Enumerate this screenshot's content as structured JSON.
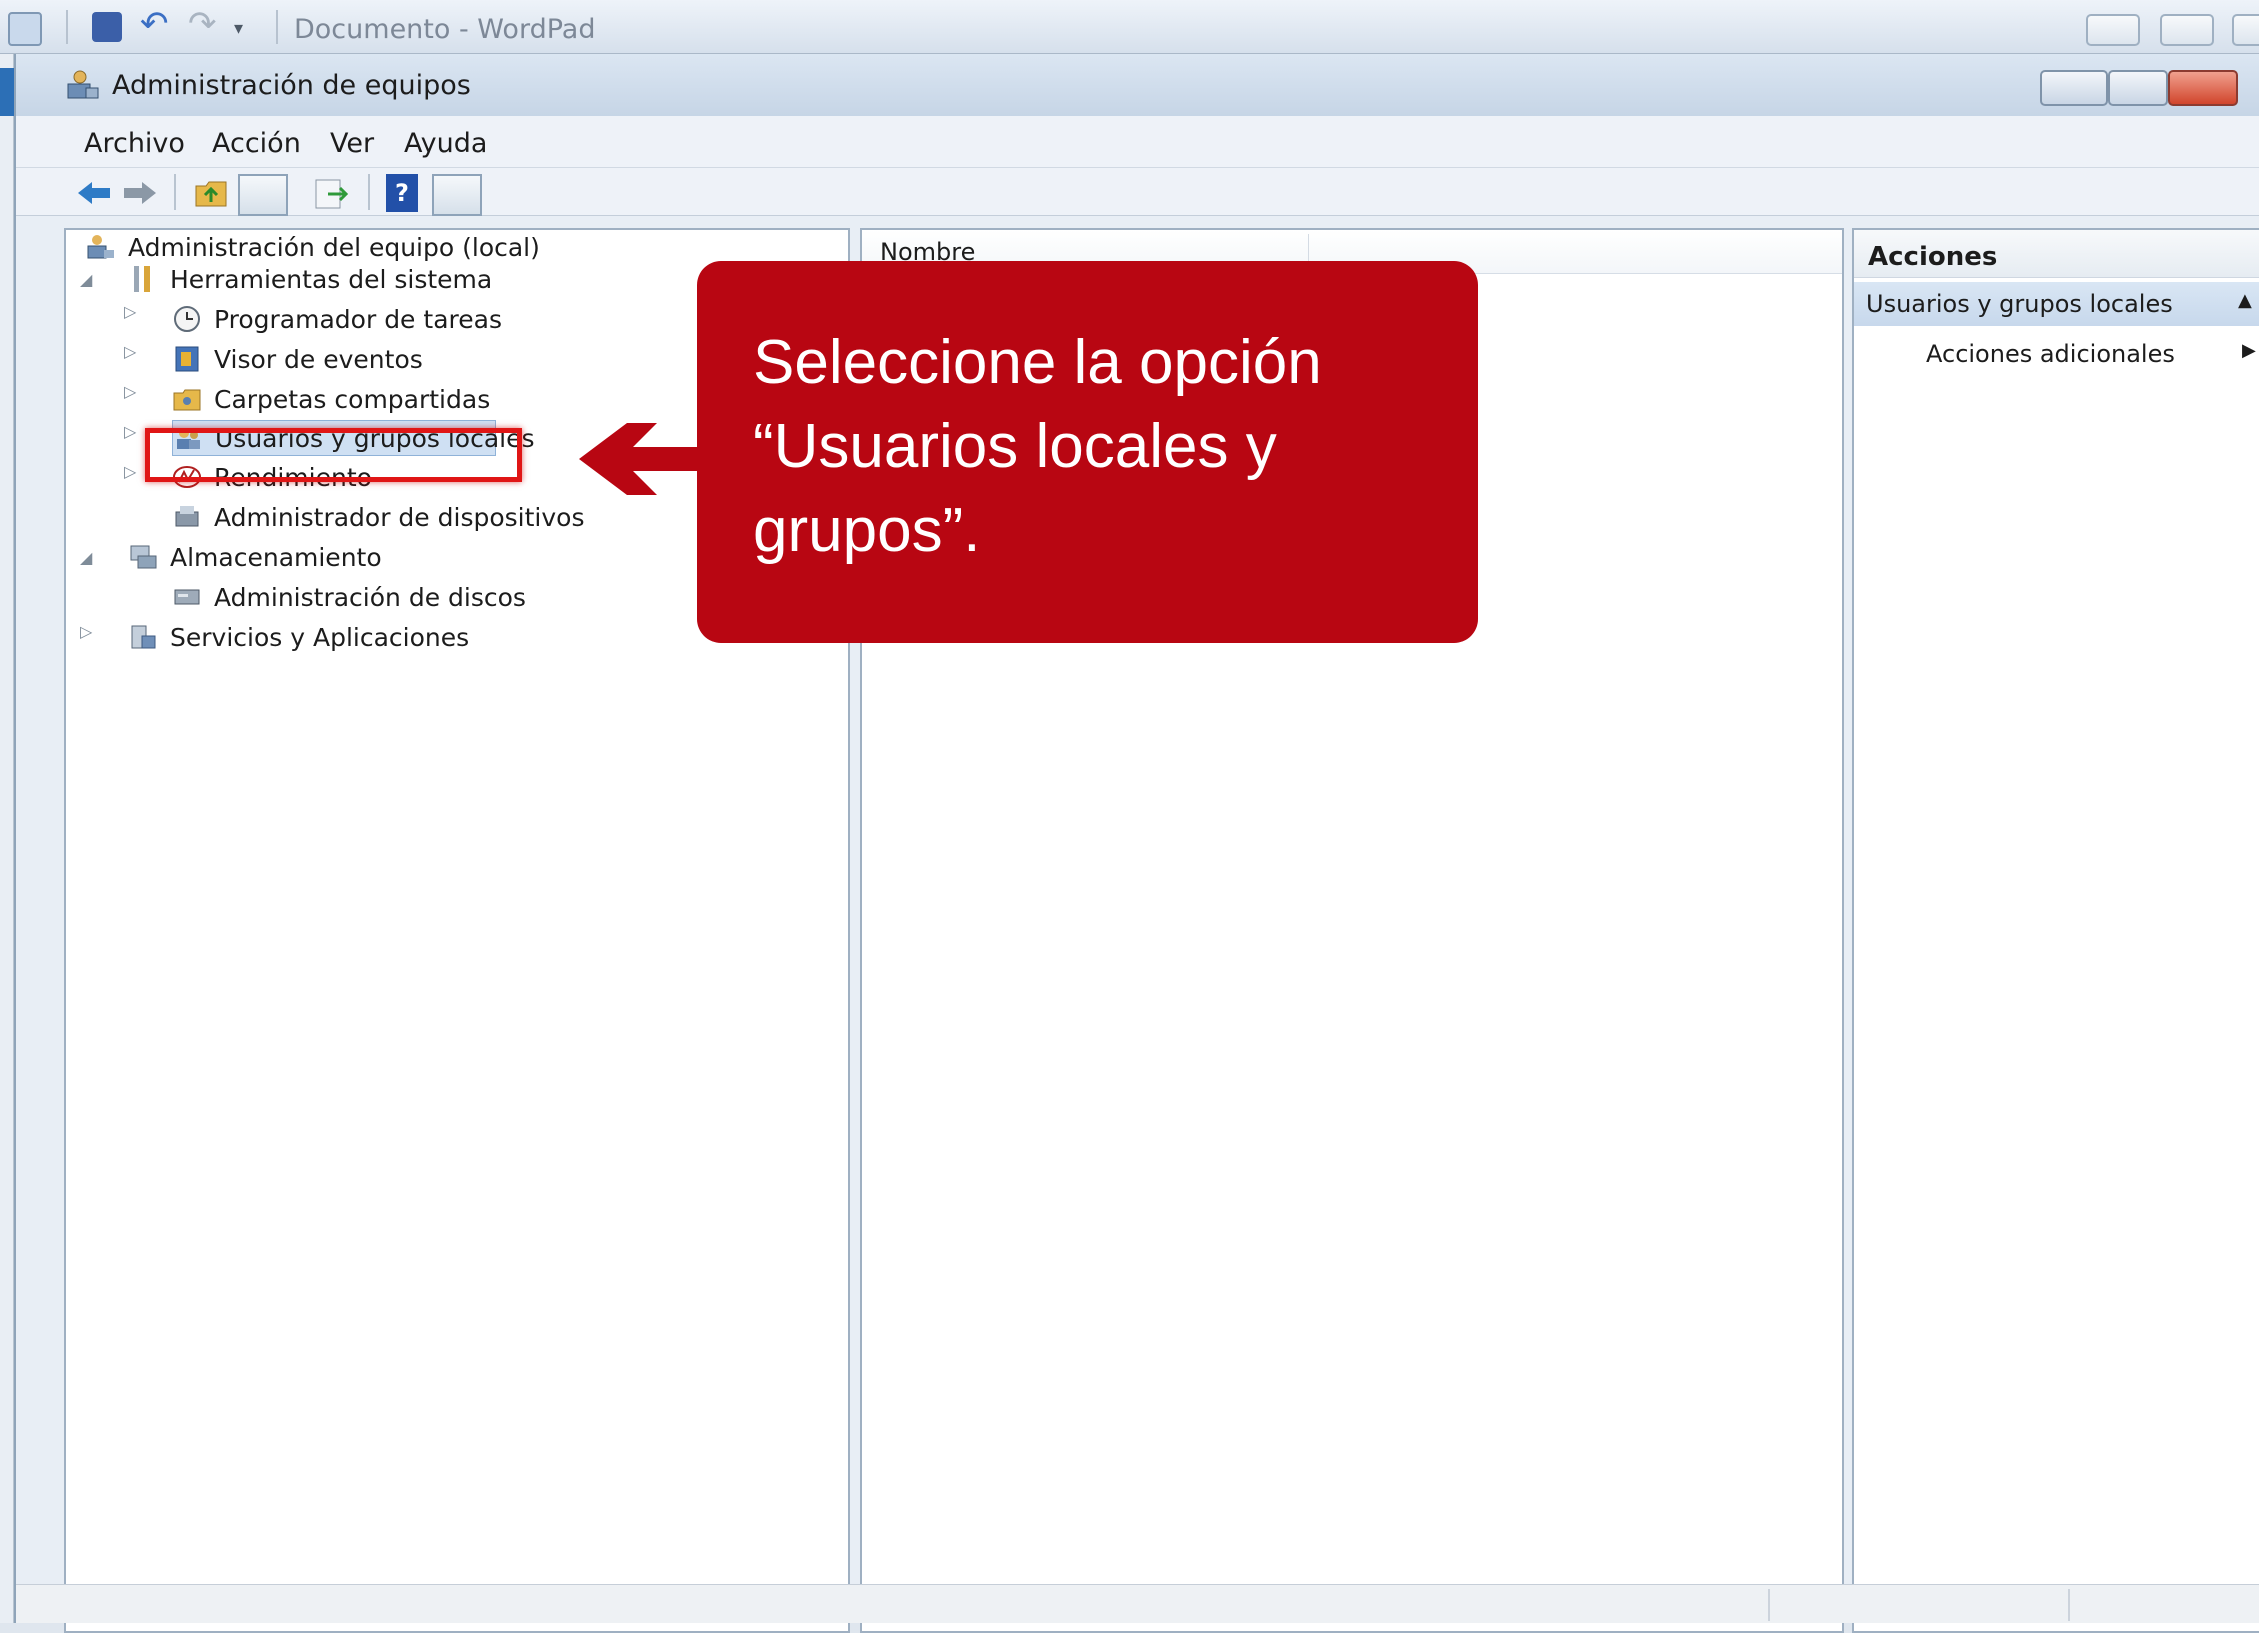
{
  "background_window": {
    "title": "Documento - WordPad"
  },
  "window": {
    "title": "Administración de equipos"
  },
  "menu": {
    "items": [
      "Archivo",
      "Acción",
      "Ver",
      "Ayuda"
    ]
  },
  "tree": {
    "root": "Administración del equipo (local)",
    "system_tools": "Herramientas del sistema",
    "task_scheduler": "Programador de tareas",
    "event_viewer": "Visor de eventos",
    "shared_folders": "Carpetas compartidas",
    "local_users_groups": "Usuarios y grupos locales",
    "performance": "Rendimiento",
    "device_manager": "Administrador de dispositivos",
    "storage": "Almacenamiento",
    "disk_management": "Administración de discos",
    "services_apps": "Servicios y Aplicaciones"
  },
  "list": {
    "column_name": "Nombre"
  },
  "actions": {
    "title": "Acciones",
    "group_label": "Usuarios y grupos locales",
    "more_actions": "Acciones adicionales"
  },
  "callout": {
    "text": "Seleccione la opción “Usuarios locales y grupos”."
  },
  "colors": {
    "callout": "#b80612",
    "highlight": "#e01616"
  }
}
